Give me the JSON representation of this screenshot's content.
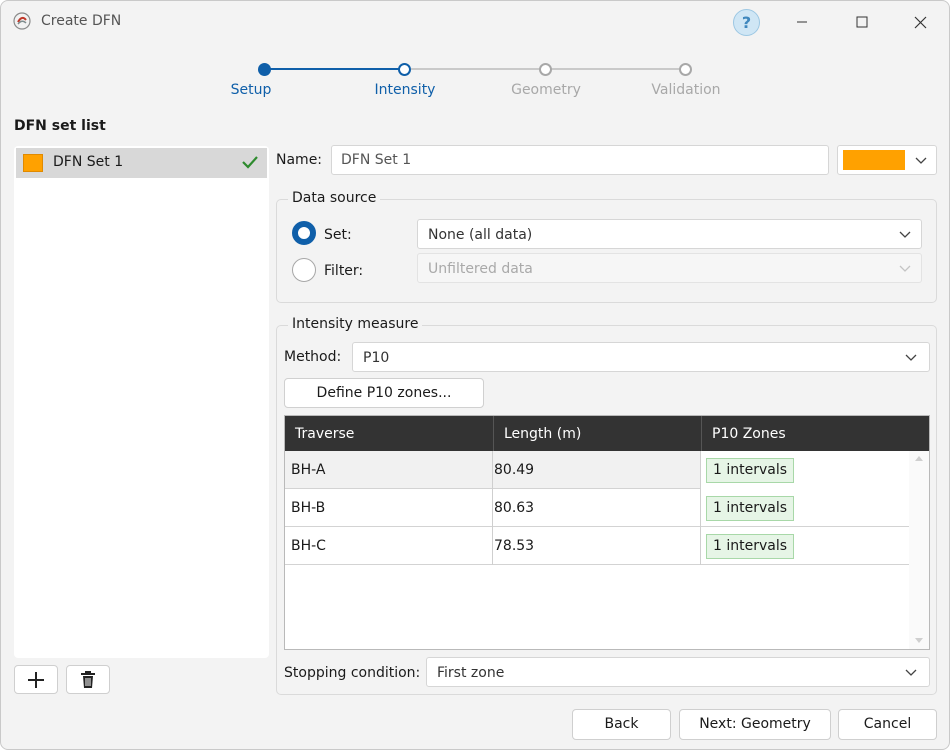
{
  "window": {
    "title": "Create DFN",
    "help_label": "?"
  },
  "stepper": {
    "steps": [
      {
        "label": "Setup",
        "state": "completed"
      },
      {
        "label": "Intensity",
        "state": "current"
      },
      {
        "label": "Geometry",
        "state": "upcoming"
      },
      {
        "label": "Validation",
        "state": "upcoming"
      }
    ],
    "active_color": "#0f5fa9",
    "inactive_color": "#a8a8a8"
  },
  "set_list": {
    "title": "DFN set list",
    "items": [
      {
        "name": "DFN Set 1",
        "color": "#ffa100",
        "status_icon": "check-icon"
      }
    ]
  },
  "name_field": {
    "label": "Name:",
    "value": "DFN Set 1",
    "color": "#ffa100"
  },
  "data_source": {
    "title": "Data source",
    "set_label": "Set:",
    "set_value": "None (all data)",
    "filter_label": "Filter:",
    "filter_value": "Unfiltered data"
  },
  "intensity": {
    "title": "Intensity measure",
    "method_label": "Method:",
    "method_value": "P10",
    "define_button": "Define P10 zones...",
    "table": {
      "headers": [
        "Traverse",
        "Length (m)",
        "P10 Zones"
      ],
      "rows": [
        {
          "traverse": "BH-A",
          "length": "80.49",
          "zones": "1 intervals"
        },
        {
          "traverse": "BH-B",
          "length": "80.63",
          "zones": "1 intervals"
        },
        {
          "traverse": "BH-C",
          "length": "78.53",
          "zones": "1 intervals"
        }
      ]
    },
    "stopping_label": "Stopping condition:",
    "stopping_value": "First zone"
  },
  "footer": {
    "back": "Back",
    "next": "Next: Geometry",
    "cancel": "Cancel"
  }
}
